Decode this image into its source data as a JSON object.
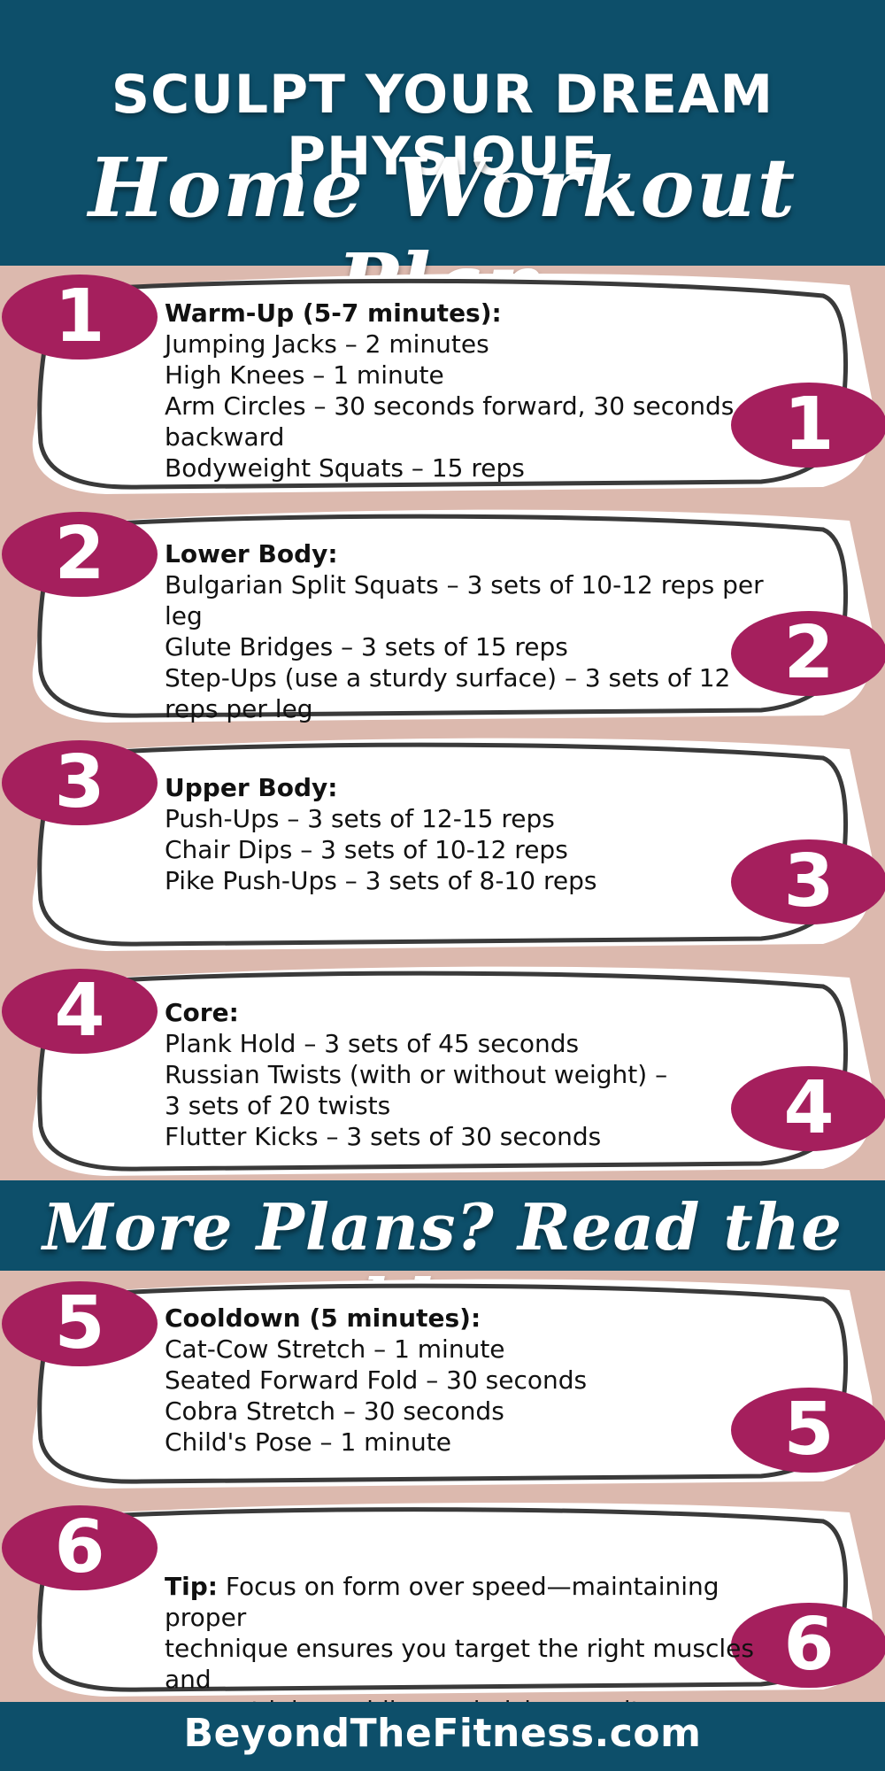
{
  "header": {
    "title": "SCULPT YOUR DREAM PHYSIQUE",
    "subtitle": "Home Workout Plan"
  },
  "sections": [
    {
      "number": "1",
      "heading": "Warm-Up (5-7 minutes):",
      "items": [
        "Jumping Jacks – 2 minutes",
        "High Knees – 1 minute",
        "Arm Circles – 30 seconds forward, 30 seconds",
        "backward",
        "Bodyweight Squats – 15 reps"
      ]
    },
    {
      "number": "2",
      "heading": "Lower Body:",
      "items": [
        "Bulgarian Split Squats – 3 sets of 10-12 reps per leg",
        "Glute Bridges – 3 sets of 15 reps",
        "Step-Ups (use a sturdy surface) – 3 sets of 12",
        "reps per leg"
      ]
    },
    {
      "number": "3",
      "heading": "Upper Body:",
      "items": [
        "Push-Ups – 3 sets of 12-15 reps",
        "Chair Dips – 3 sets of 10-12 reps",
        "Pike Push-Ups – 3 sets of 8-10 reps"
      ]
    },
    {
      "number": "4",
      "heading": "Core:",
      "items": [
        "Plank Hold – 3 sets of 45 seconds",
        "Russian Twists (with or without weight) –",
        "3 sets of 20 twists",
        "Flutter Kicks – 3 sets of 30 seconds"
      ]
    },
    {
      "number": "5",
      "heading": "Cooldown (5 minutes):",
      "items": [
        "Cat-Cow Stretch – 1 minute",
        "Seated Forward Fold – 30 seconds",
        "Cobra Stretch – 30 seconds",
        "Child's Pose – 1 minute"
      ]
    }
  ],
  "tip": {
    "number": "6",
    "label": "Tip:",
    "lines": [
      "Focus on form over speed—maintaining proper",
      "technique ensures you target the right muscles and",
      "prevent injury while maximizing results."
    ]
  },
  "blog_cta": "More Plans? Read the blog",
  "footer": {
    "site": "BeyondTheFitness.com"
  },
  "colors": {
    "band": "#0d4f6a",
    "background": "#dcb9ae",
    "badge": "#a51f5d",
    "card": "#ffffff",
    "outline": "#3a3a3a"
  }
}
